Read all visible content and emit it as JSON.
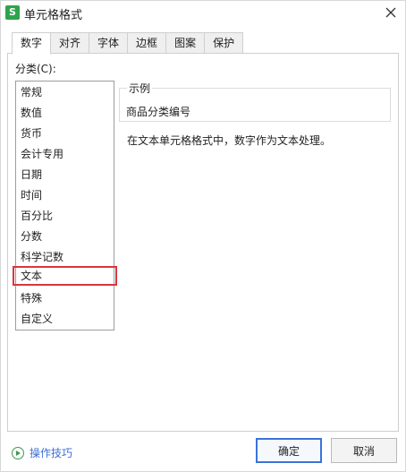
{
  "window": {
    "app_icon": "S",
    "title": "单元格格式",
    "close_icon": "close-icon"
  },
  "tabs": [
    {
      "label": "数字",
      "active": true
    },
    {
      "label": "对齐",
      "active": false
    },
    {
      "label": "字体",
      "active": false
    },
    {
      "label": "边框",
      "active": false
    },
    {
      "label": "图案",
      "active": false
    },
    {
      "label": "保护",
      "active": false
    }
  ],
  "category": {
    "label": "分类(C):",
    "items": [
      "常规",
      "数值",
      "货币",
      "会计专用",
      "日期",
      "时间",
      "百分比",
      "分数",
      "科学记数",
      "文本",
      "特殊",
      "自定义"
    ],
    "selected": "文本"
  },
  "sample": {
    "title": "示例",
    "value": "商品分类编号"
  },
  "description": "在文本单元格格式中，数字作为文本处理。",
  "footer": {
    "tips_label": "操作技巧",
    "ok_label": "确定",
    "cancel_label": "取消"
  },
  "colors": {
    "app_icon_bg": "#2fa34c",
    "selection_border": "#d9363e",
    "link": "#3c6fd4",
    "ok_border": "#3a73d8"
  }
}
